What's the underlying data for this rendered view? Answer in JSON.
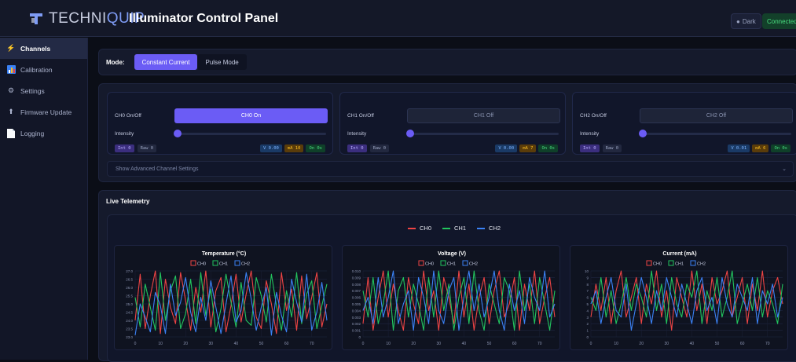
{
  "header": {
    "logo_prefix": "TECHNI",
    "logo_suffix": "QUIP",
    "title": "Illuminator Control Panel",
    "theme_label": "Dark",
    "connection_label": "Connected",
    "colors": {
      "accent": "#6b5cf5",
      "connected": "#4ade80"
    }
  },
  "sidebar": {
    "items": [
      {
        "label": "Channels",
        "icon": "lightning-icon",
        "active": true
      },
      {
        "label": "Calibration",
        "icon": "chart-icon",
        "active": false
      },
      {
        "label": "Settings",
        "icon": "gear-icon",
        "active": false
      },
      {
        "label": "Firmware Update",
        "icon": "upload-icon",
        "active": false
      },
      {
        "label": "Logging",
        "icon": "document-icon",
        "active": false
      }
    ]
  },
  "mode": {
    "label": "Mode:",
    "options": [
      "Constant Current",
      "Pulse Mode"
    ],
    "selected": "Constant Current"
  },
  "channels": [
    {
      "name": "CH0 On/Off",
      "button": "CH0 On",
      "state": "on",
      "intensity_label": "Intensity",
      "intensity": 0,
      "int_badge": "Int 0",
      "raw_badge": "Raw 0",
      "v_badge": "V 0.00",
      "ma_badge": "mA 10",
      "on_badge": "On 0s"
    },
    {
      "name": "CH1 On/Off",
      "button": "CH1 Off",
      "state": "off",
      "intensity_label": "Intensity",
      "intensity": 0,
      "int_badge": "Int 0",
      "raw_badge": "Raw 0",
      "v_badge": "V 0.00",
      "ma_badge": "mA 7",
      "on_badge": "On 0s"
    },
    {
      "name": "CH2 On/Off",
      "button": "CH2 Off",
      "state": "off",
      "intensity_label": "Intensity",
      "intensity": 0,
      "int_badge": "Int 0",
      "raw_badge": "Raw 0",
      "v_badge": "V 0.01",
      "ma_badge": "mA 6",
      "on_badge": "On 0s"
    }
  ],
  "advanced": {
    "label": "Show Advanced Channel Settings",
    "chevron": "chevron-down-icon"
  },
  "telemetry": {
    "title": "Live Telemetry",
    "legend": [
      {
        "name": "CH0",
        "color": "#ef4444"
      },
      {
        "name": "CH1",
        "color": "#22c55e"
      },
      {
        "name": "CH2",
        "color": "#3b82f6"
      }
    ]
  },
  "chart_data": [
    {
      "type": "line",
      "title": "Temperature (°C)",
      "legend": [
        "CH0",
        "CH1",
        "CH2"
      ],
      "x_ticks": [
        0,
        10,
        20,
        30,
        40,
        50,
        60,
        70
      ],
      "y_ticks": [
        "27.0",
        "26.5",
        "26.0",
        "25.5",
        "25.0",
        "24.5",
        "24.0",
        "23.5",
        "23.0"
      ],
      "ylim": [
        23.0,
        27.0
      ],
      "x": [
        0,
        2,
        4,
        6,
        8,
        10,
        12,
        14,
        16,
        18,
        20,
        22,
        24,
        26,
        28,
        30,
        32,
        34,
        36,
        38,
        40,
        42,
        44,
        46,
        48,
        50,
        52,
        54,
        56,
        58,
        60,
        62,
        64,
        66,
        68,
        70,
        72,
        74,
        76
      ],
      "series": [
        {
          "name": "CH0",
          "color": "#ef4444",
          "values": [
            24.0,
            26.8,
            23.5,
            25.5,
            27.0,
            23.2,
            26.5,
            24.8,
            23.8,
            26.9,
            25.2,
            23.4,
            26.0,
            24.5,
            27.0,
            23.6,
            25.8,
            26.6,
            23.3,
            24.9,
            26.8,
            23.9,
            25.6,
            27.0,
            24.2,
            23.5,
            26.4,
            25.0,
            23.2,
            26.9,
            24.6,
            25.9,
            23.4,
            26.7,
            24.1,
            25.4,
            26.9,
            23.6,
            25.0
          ]
        },
        {
          "name": "CH1",
          "color": "#22c55e",
          "values": [
            25.4,
            23.6,
            26.2,
            24.8,
            23.4,
            26.9,
            24.0,
            25.8,
            26.7,
            23.5,
            24.4,
            26.5,
            23.8,
            26.9,
            24.3,
            25.9,
            23.3,
            24.7,
            26.8,
            25.1,
            23.6,
            26.3,
            24.0,
            23.7,
            26.6,
            25.5,
            23.9,
            26.8,
            24.9,
            23.4,
            25.8,
            24.2,
            26.9,
            23.8,
            25.6,
            26.4,
            23.5,
            24.9,
            26.2
          ]
        },
        {
          "name": "CH2",
          "color": "#3b82f6",
          "values": [
            23.1,
            25.0,
            24.2,
            23.3,
            25.7,
            24.9,
            23.2,
            26.2,
            24.3,
            25.1,
            26.6,
            24.5,
            23.3,
            25.4,
            24.0,
            26.4,
            24.8,
            23.2,
            25.0,
            26.7,
            23.9,
            24.6,
            26.9,
            25.3,
            23.4,
            24.8,
            26.0,
            23.1,
            25.7,
            24.3,
            23.3,
            26.5,
            25.1,
            23.9,
            26.8,
            23.4,
            24.5,
            26.3,
            24.0
          ]
        }
      ]
    },
    {
      "type": "line",
      "title": "Voltage (V)",
      "legend": [
        "CH0",
        "CH1",
        "CH2"
      ],
      "x_ticks": [
        0,
        10,
        20,
        30,
        40,
        50,
        60,
        70
      ],
      "y_ticks": [
        "0.010",
        "0.009",
        "0.008",
        "0.007",
        "0.006",
        "0.005",
        "0.004",
        "0.003",
        "0.002",
        "0.001",
        "0"
      ],
      "ylim": [
        0,
        0.01
      ],
      "x": [
        0,
        2,
        4,
        6,
        8,
        10,
        12,
        14,
        16,
        18,
        20,
        22,
        24,
        26,
        28,
        30,
        32,
        34,
        36,
        38,
        40,
        42,
        44,
        46,
        48,
        50,
        52,
        54,
        56,
        58,
        60,
        62,
        64,
        66,
        68,
        70,
        72,
        74,
        76
      ],
      "series": [
        {
          "name": "CH0",
          "color": "#ef4444",
          "values": [
            0.002,
            0.009,
            0.001,
            0.006,
            0.01,
            0.003,
            0.008,
            0.004,
            0.001,
            0.009,
            0.005,
            0.002,
            0.01,
            0.004,
            0.007,
            0.001,
            0.009,
            0.006,
            0.002,
            0.01,
            0.003,
            0.008,
            0.001,
            0.006,
            0.009,
            0.002,
            0.007,
            0.01,
            0.003,
            0.005,
            0.009,
            0.001,
            0.008,
            0.004,
            0.01,
            0.002,
            0.006,
            0.009,
            0.003
          ]
        },
        {
          "name": "CH1",
          "color": "#22c55e",
          "values": [
            0.007,
            0.003,
            0.009,
            0.002,
            0.005,
            0.01,
            0.001,
            0.007,
            0.009,
            0.003,
            0.008,
            0.005,
            0.001,
            0.009,
            0.003,
            0.01,
            0.004,
            0.008,
            0.001,
            0.006,
            0.009,
            0.002,
            0.01,
            0.004,
            0.001,
            0.008,
            0.005,
            0.002,
            0.009,
            0.007,
            0.001,
            0.01,
            0.004,
            0.008,
            0.002,
            0.009,
            0.005,
            0.001,
            0.007
          ]
        },
        {
          "name": "CH2",
          "color": "#3b82f6",
          "values": [
            0.004,
            0.006,
            0.002,
            0.009,
            0.003,
            0.006,
            0.01,
            0.002,
            0.005,
            0.007,
            0.001,
            0.009,
            0.006,
            0.002,
            0.01,
            0.004,
            0.002,
            0.007,
            0.009,
            0.001,
            0.006,
            0.01,
            0.004,
            0.008,
            0.003,
            0.006,
            0.01,
            0.004,
            0.001,
            0.008,
            0.004,
            0.007,
            0.002,
            0.009,
            0.006,
            0.004,
            0.01,
            0.003,
            0.005
          ]
        }
      ]
    },
    {
      "type": "line",
      "title": "Current (mA)",
      "legend": [
        "CH0",
        "CH1",
        "CH2"
      ],
      "x_ticks": [
        0,
        10,
        20,
        30,
        40,
        50,
        60,
        70
      ],
      "y_ticks": [
        "10",
        "9",
        "8",
        "7",
        "6",
        "5",
        "4",
        "3",
        "2",
        "1",
        "0"
      ],
      "ylim": [
        0,
        10
      ],
      "x": [
        0,
        2,
        4,
        6,
        8,
        10,
        12,
        14,
        16,
        18,
        20,
        22,
        24,
        26,
        28,
        30,
        32,
        34,
        36,
        38,
        40,
        42,
        44,
        46,
        48,
        50,
        52,
        54,
        56,
        58,
        60,
        62,
        64,
        66,
        68,
        70,
        72,
        74,
        76
      ],
      "series": [
        {
          "name": "CH0",
          "color": "#ef4444",
          "values": [
            3,
            8,
            4,
            9,
            2,
            7,
            10,
            3,
            6,
            9,
            2,
            8,
            5,
            10,
            3,
            7,
            1,
            9,
            6,
            3,
            10,
            4,
            8,
            2,
            9,
            5,
            7,
            10,
            3,
            6,
            9,
            2,
            8,
            4,
            10,
            3,
            7,
            9,
            5
          ]
        },
        {
          "name": "CH1",
          "color": "#22c55e",
          "values": [
            6,
            4,
            9,
            3,
            7,
            2,
            5,
            9,
            4,
            8,
            6,
            3,
            10,
            4,
            8,
            2,
            9,
            5,
            3,
            8,
            6,
            10,
            2,
            7,
            4,
            9,
            3,
            6,
            10,
            2,
            5,
            8,
            4,
            9,
            3,
            7,
            5,
            2,
            8
          ]
        },
        {
          "name": "CH2",
          "color": "#3b82f6",
          "values": [
            5,
            7,
            2,
            6,
            9,
            4,
            3,
            8,
            1,
            5,
            9,
            6,
            2,
            7,
            4,
            9,
            6,
            3,
            8,
            5,
            2,
            7,
            9,
            4,
            6,
            2,
            9,
            5,
            3,
            8,
            6,
            4,
            9,
            2,
            7,
            5,
            8,
            3,
            6
          ]
        }
      ]
    }
  ]
}
